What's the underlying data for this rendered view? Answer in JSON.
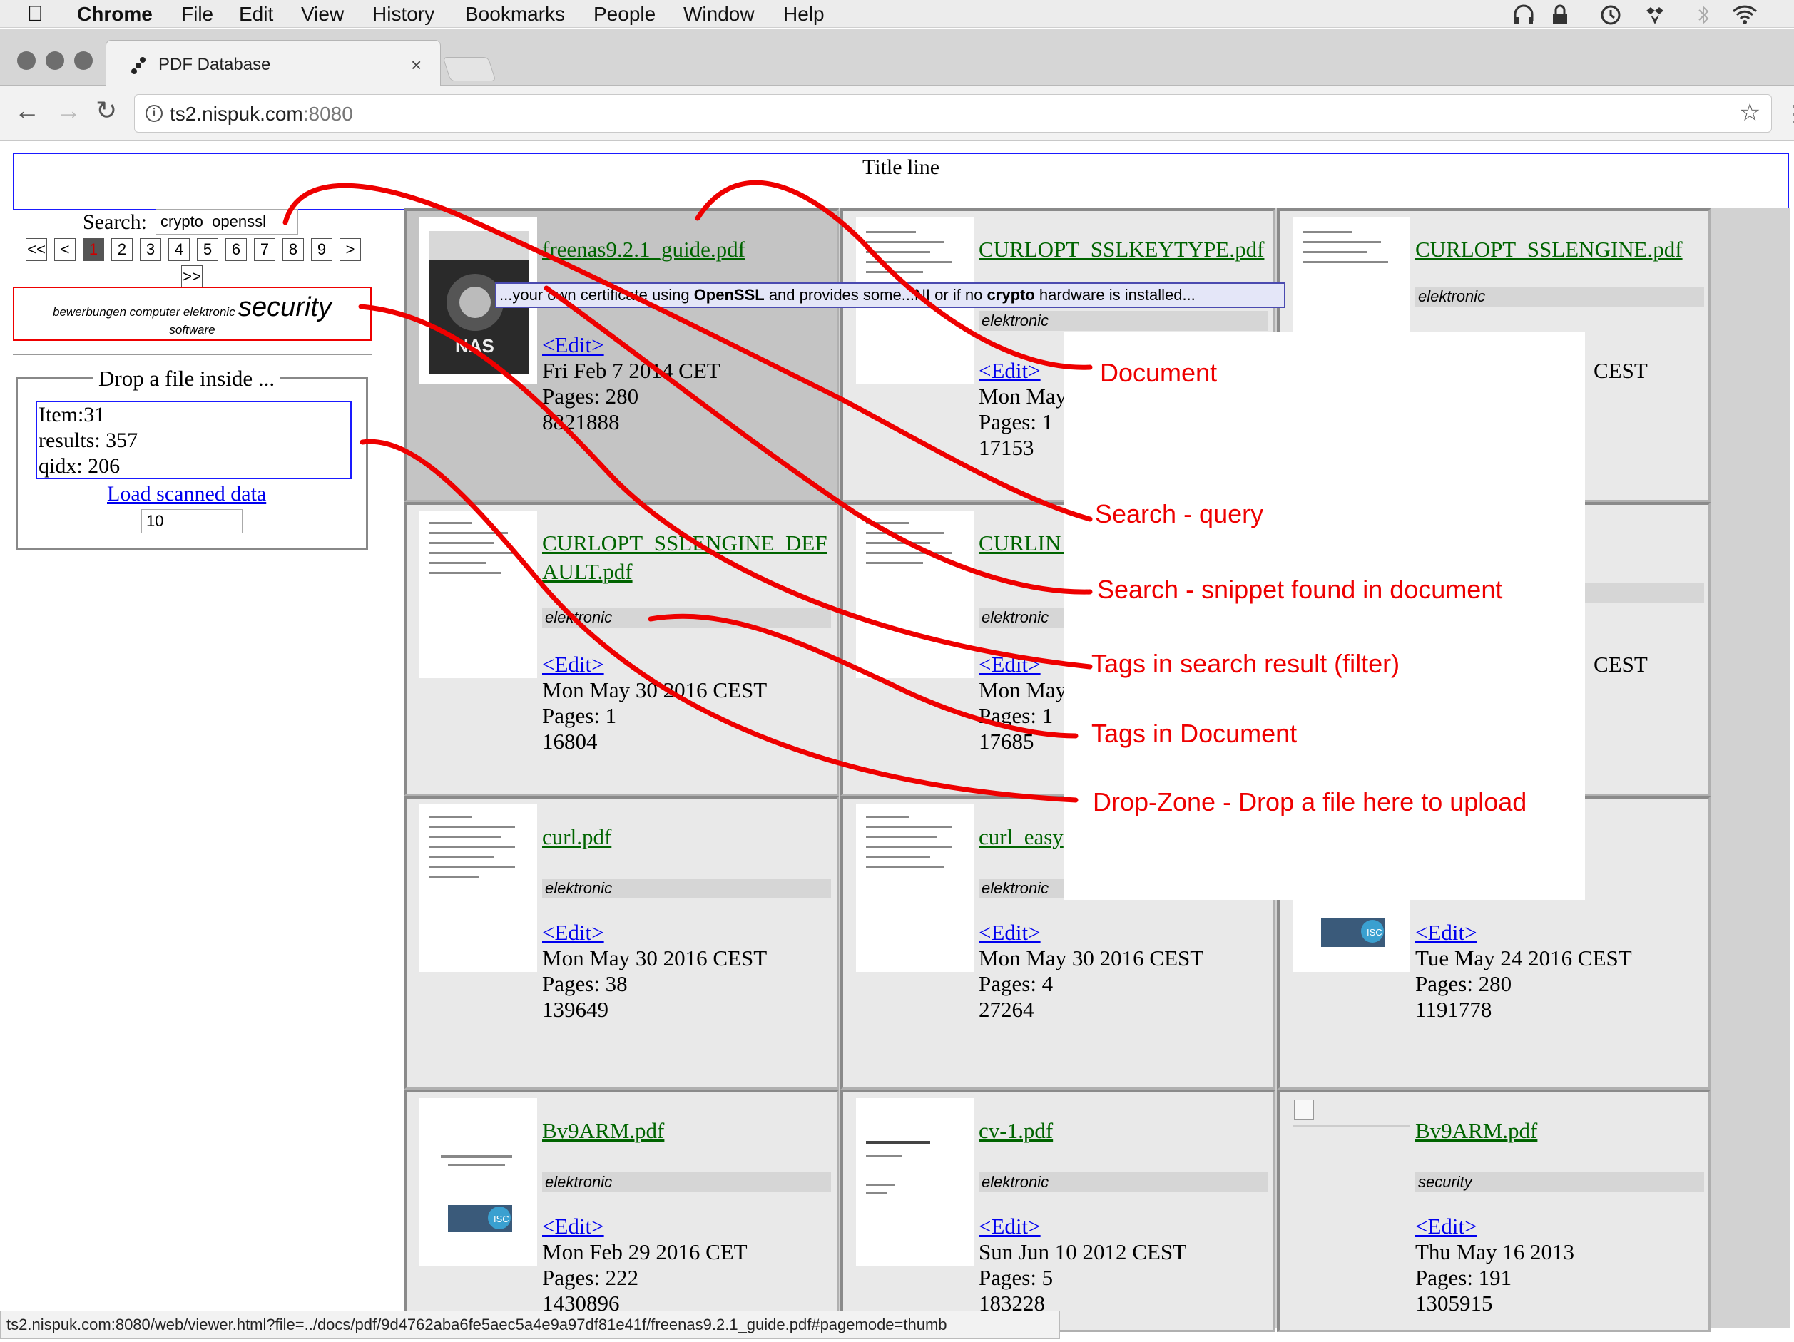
{
  "menubar": {
    "app": "Chrome",
    "items": [
      "File",
      "Edit",
      "View",
      "History",
      "Bookmarks",
      "People",
      "Window",
      "Help"
    ]
  },
  "browser": {
    "tab_title": "PDF Database",
    "url_host": "ts2.nispuk.com",
    "url_port": ":8080"
  },
  "page": {
    "title_line": "Title line",
    "search": {
      "label": "Search:",
      "value": "crypto  openssl"
    },
    "pagination": {
      "first": "<<",
      "prev": "<",
      "pages": [
        "1",
        "2",
        "3",
        "4",
        "5",
        "6",
        "7",
        "8",
        "9"
      ],
      "current": "1",
      "next": ">",
      "last": ">>"
    },
    "tagcloud": {
      "t1": "bewerbungen",
      "t2": "computer",
      "t3": "elektronic",
      "t4": "security",
      "t5": "software"
    },
    "dropzone": {
      "legend": "Drop a file inside ...",
      "item": "Item:31",
      "results": "results: 357",
      "qidx": "qidx: 206",
      "load_link": "Load scanned data",
      "load_value": "10"
    },
    "snippet": {
      "p1": "...your own certificate using ",
      "b1": "OpenSSL",
      "p2": " and provides some...NI or if no ",
      "b2": "crypto",
      "p3": " hardware is installed..."
    },
    "documents": [
      {
        "name": "freenas9.2.1_guide.pdf ",
        "tag": "",
        "edit": "<Edit> ",
        "date": "Fri Feb 7 2014 CET",
        "pages": "Pages: 280",
        "size": "8821888"
      },
      {
        "name": "CURLOPT_SSLKEYTYPE.pdf ",
        "tag": "elektronic",
        "edit": "<Edit> ",
        "date": "Mon May",
        "pages": "Pages: 1",
        "size": "17153"
      },
      {
        "name": "CURLOPT_SSLENGINE.pdf ",
        "tag": "elektronic",
        "edit": "",
        "date": "CEST",
        "pages": "",
        "size": ""
      },
      {
        "name": "CURLOPT_SSLENGINE_DEFAULT.pdf ",
        "tag": "elektronic",
        "edit": "<Edit> ",
        "date": "Mon May 30 2016 CEST",
        "pages": "Pages: 1",
        "size": "16804"
      },
      {
        "name": "CURLIN pdf ",
        "tag": "elektronic",
        "edit": "<Edit> ",
        "date": "Mon May",
        "pages": "Pages: 1",
        "size": "17685"
      },
      {
        "name": "",
        "tag": "",
        "edit": "",
        "date": "CEST",
        "pages": "",
        "size": ""
      },
      {
        "name": "curl.pdf ",
        "tag": "elektronic",
        "edit": "<Edit> ",
        "date": "Mon May 30 2016 CEST",
        "pages": "Pages: 38",
        "size": "139649"
      },
      {
        "name": "curl_easy",
        "tag": "elektronic",
        "edit": "<Edit> ",
        "date": "Mon May 30 2016 CEST",
        "pages": "Pages: 4",
        "size": "27264"
      },
      {
        "name": "",
        "tag": "",
        "edit": "<Edit> ",
        "date": "Tue May 24 2016 CEST",
        "pages": "Pages: 280",
        "size": "1191778"
      },
      {
        "name": "Bv9ARM.pdf ",
        "tag": "elektronic",
        "edit": "<Edit> ",
        "date": "Mon Feb 29 2016 CET",
        "pages": "Pages: 222",
        "size": "1430896"
      },
      {
        "name": "cv-1.pdf ",
        "tag": "elektronic",
        "edit": "<Edit> ",
        "date": "Sun Jun 10 2012 CEST",
        "pages": "Pages: 5",
        "size": "183228"
      },
      {
        "name": "Bv9ARM.pdf ",
        "tag": "security",
        "edit": "<Edit> ",
        "date": "Thu May 16 2013",
        "pages": "Pages: 191",
        "size": "1305915"
      }
    ]
  },
  "annotations": {
    "document": "Document",
    "search_query": "Search - query",
    "snippet": "Search - snippet found in document",
    "tags_filter": "Tags in search result (filter)",
    "tags_doc": "Tags in Document",
    "dropzone": "Drop-Zone - Drop a file here to upload"
  },
  "statusbar": "ts2.nispuk.com:8080/web/viewer.html?file=../docs/pdf/9d4762aba6fe5aec5a4e9a97df81e41f/freenas9.2.1_guide.pdf#pagemode=thumb",
  "colors": {
    "annotation": "#e00000",
    "link": "#0000ee",
    "doc_link": "#006400",
    "frame": "#1a1aff"
  }
}
